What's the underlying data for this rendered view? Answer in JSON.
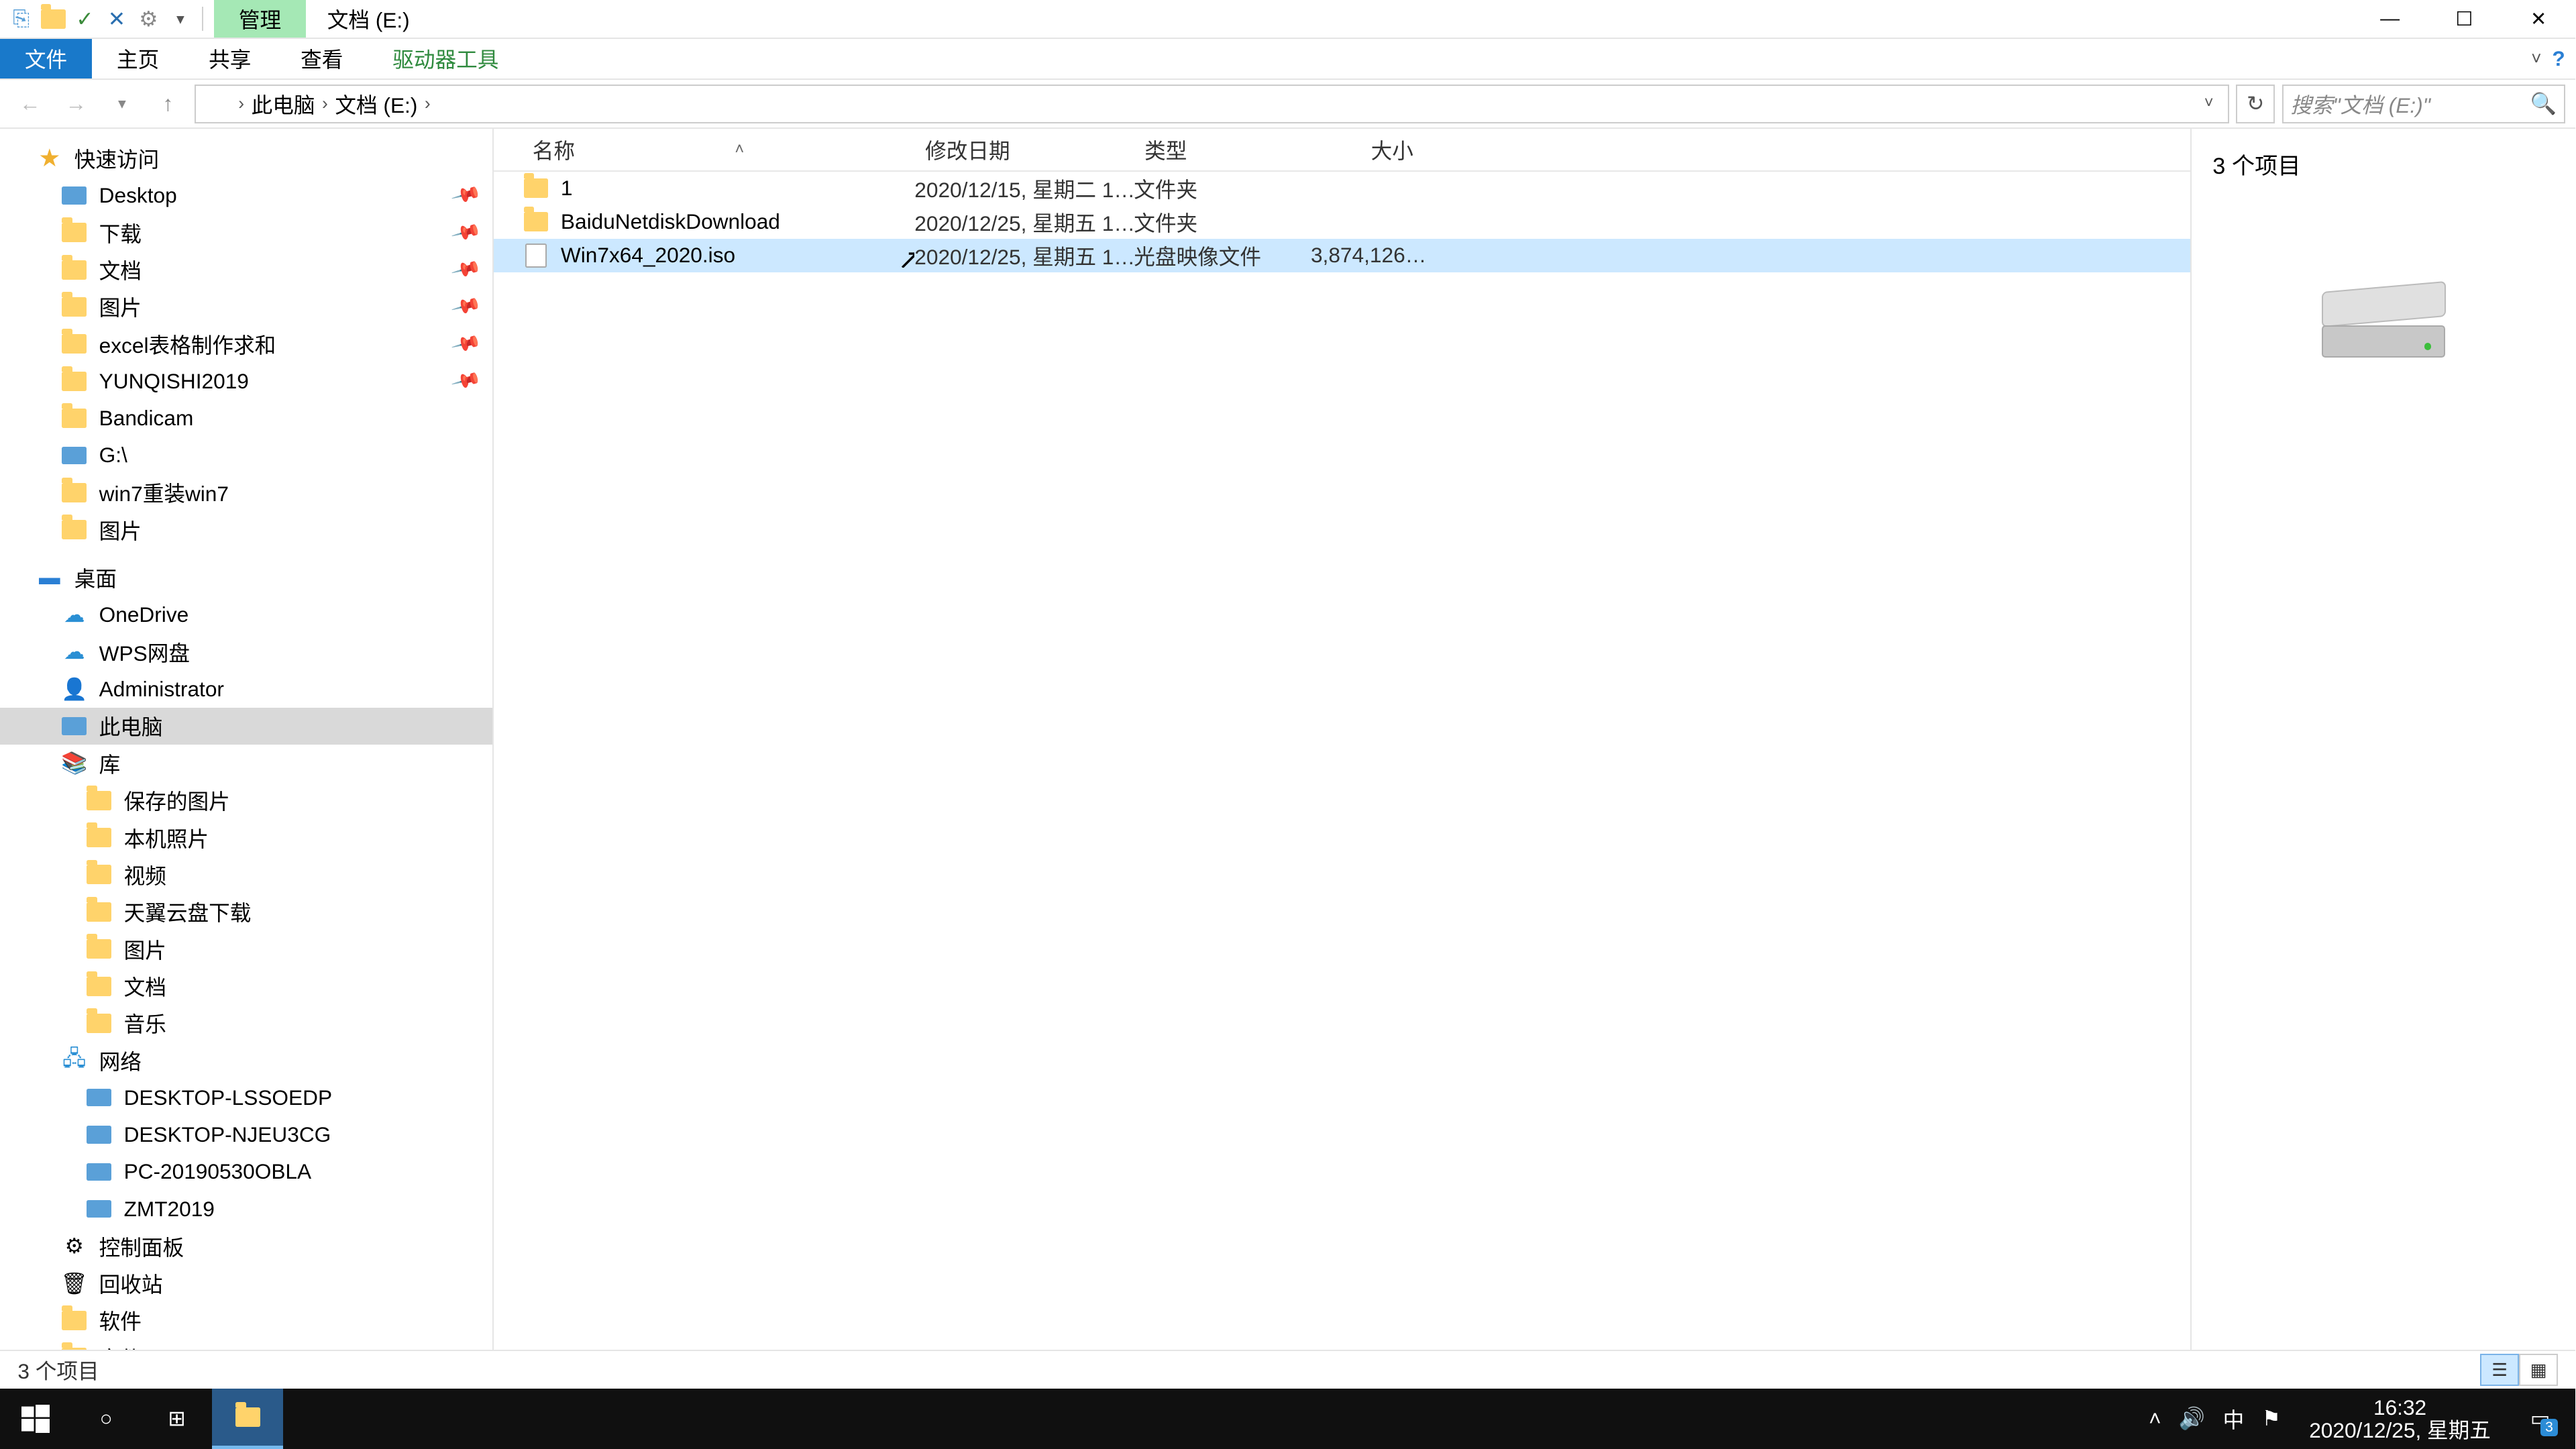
{
  "title": {
    "manage": "管理",
    "location": "文档 (E:)"
  },
  "win": {
    "help": "?"
  },
  "ribbon": {
    "file": "文件",
    "home": "主页",
    "share": "共享",
    "view": "查看",
    "drive": "驱动器工具"
  },
  "address": {
    "crumbs": [
      "此电脑",
      "文档 (E:)"
    ],
    "search_placeholder": "搜索\"文档 (E:)\""
  },
  "nav": {
    "quick": {
      "label": "快速访问",
      "items": [
        {
          "label": "Desktop",
          "pinned": true,
          "icon": "disk"
        },
        {
          "label": "下载",
          "pinned": true,
          "icon": "folder"
        },
        {
          "label": "文档",
          "pinned": true,
          "icon": "folder"
        },
        {
          "label": "图片",
          "pinned": true,
          "icon": "folder"
        },
        {
          "label": "excel表格制作求和",
          "pinned": true,
          "icon": "folder"
        },
        {
          "label": "YUNQISHI2019",
          "pinned": true,
          "icon": "folder"
        },
        {
          "label": "Bandicam",
          "pinned": false,
          "icon": "folder"
        },
        {
          "label": "G:\\",
          "pinned": false,
          "icon": "disk"
        },
        {
          "label": "win7重装win7",
          "pinned": false,
          "icon": "folder"
        },
        {
          "label": "图片",
          "pinned": false,
          "icon": "folder"
        }
      ]
    },
    "desktop": {
      "label": "桌面",
      "items": [
        {
          "label": "OneDrive",
          "icon": "cloud"
        },
        {
          "label": "WPS网盘",
          "icon": "cloud"
        },
        {
          "label": "Administrator",
          "icon": "user"
        },
        {
          "label": "此电脑",
          "icon": "pc",
          "selected": true
        },
        {
          "label": "库",
          "icon": "lib"
        },
        {
          "label": "保存的图片",
          "icon": "folder",
          "level": 3
        },
        {
          "label": "本机照片",
          "icon": "folder",
          "level": 3
        },
        {
          "label": "视频",
          "icon": "folder",
          "level": 3
        },
        {
          "label": "天翼云盘下载",
          "icon": "folder",
          "level": 3
        },
        {
          "label": "图片",
          "icon": "folder",
          "level": 3
        },
        {
          "label": "文档",
          "icon": "folder",
          "level": 3
        },
        {
          "label": "音乐",
          "icon": "folder",
          "level": 3
        },
        {
          "label": "网络",
          "icon": "net"
        },
        {
          "label": "DESKTOP-LSSOEDP",
          "icon": "pc",
          "level": 3
        },
        {
          "label": "DESKTOP-NJEU3CG",
          "icon": "pc",
          "level": 3
        },
        {
          "label": "PC-20190530OBLA",
          "icon": "pc",
          "level": 3
        },
        {
          "label": "ZMT2019",
          "icon": "pc",
          "level": 3
        },
        {
          "label": "控制面板",
          "icon": "cp"
        },
        {
          "label": "回收站",
          "icon": "bin"
        },
        {
          "label": "软件",
          "icon": "folder"
        },
        {
          "label": "文件",
          "icon": "folder"
        }
      ]
    }
  },
  "columns": {
    "name": "名称",
    "date": "修改日期",
    "type": "类型",
    "size": "大小"
  },
  "files": [
    {
      "name": "1",
      "date": "2020/12/15, 星期二 1…",
      "type": "文件夹",
      "size": "",
      "icon": "folder",
      "selected": false
    },
    {
      "name": "BaiduNetdiskDownload",
      "date": "2020/12/25, 星期五 1…",
      "type": "文件夹",
      "size": "",
      "icon": "folder",
      "selected": false
    },
    {
      "name": "Win7x64_2020.iso",
      "date": "2020/12/25, 星期五 1…",
      "type": "光盘映像文件",
      "size": "3,874,126…",
      "icon": "file",
      "selected": true
    }
  ],
  "preview": {
    "count": "3 个项目"
  },
  "status": {
    "text": "3 个项目"
  },
  "taskbar": {
    "time": "16:32",
    "date": "2020/12/25, 星期五",
    "ime": "中",
    "notif_count": "3"
  }
}
